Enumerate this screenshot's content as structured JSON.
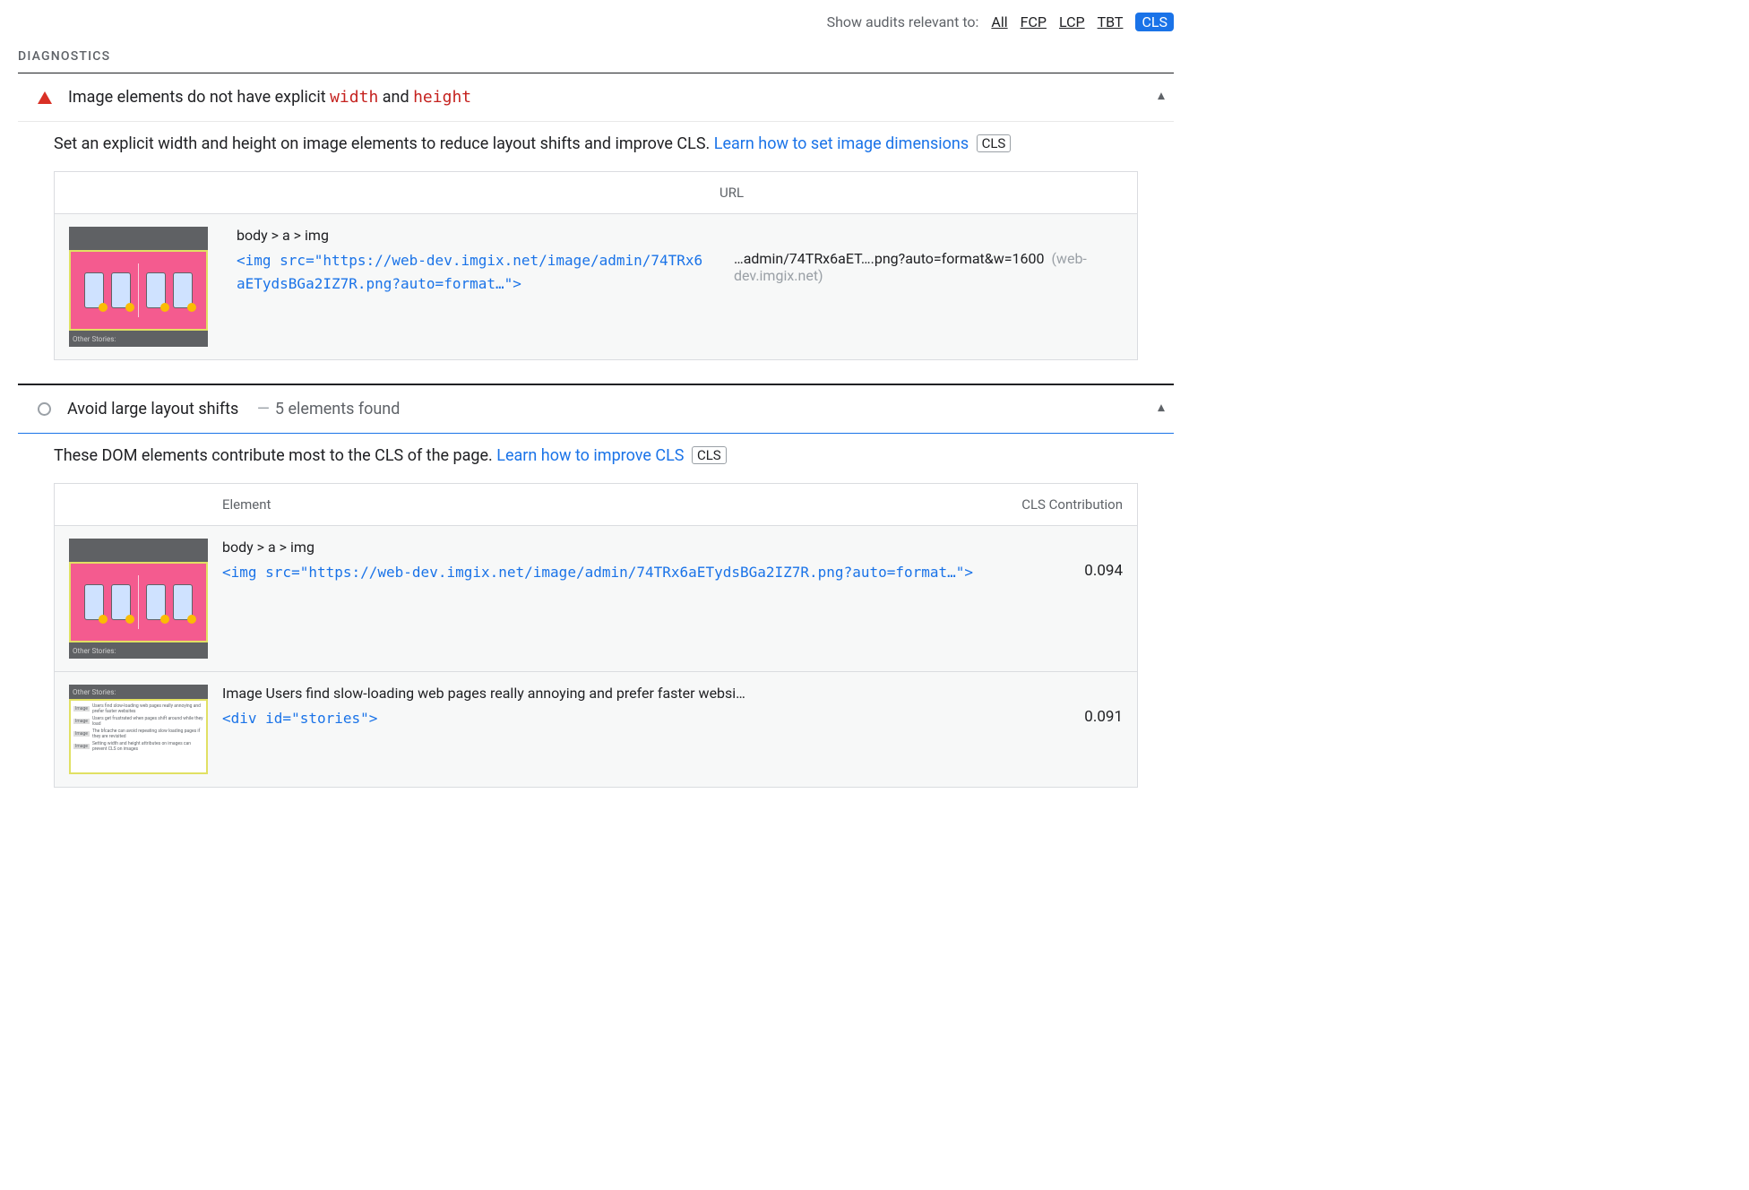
{
  "filter": {
    "label": "Show audits relevant to:",
    "items": [
      "All",
      "FCP",
      "LCP",
      "TBT",
      "CLS"
    ],
    "active": "CLS"
  },
  "section_title": "DIAGNOSTICS",
  "audit1": {
    "title_prefix": "Image elements do not have explicit ",
    "code1": "width",
    "mid": " and ",
    "code2": "height",
    "desc_text": "Set an explicit width and height on image elements to reduce layout shifts and improve CLS. ",
    "desc_link": "Learn how to set image dimensions",
    "badge": "CLS",
    "table": {
      "col_url": "URL",
      "row": {
        "selector": "body > a > img",
        "snippet": "<img src=\"https://web-dev.imgix.net/image/admin/74TRx6aETydsBGa2IZ7R.png?auto=format…\">",
        "url": "…admin/74TRx6aET….png?auto=format&w=1600",
        "host": "(web-dev.imgix.net)",
        "thumbLabel": "Other Stories:"
      }
    }
  },
  "audit2": {
    "title": "Avoid large layout shifts",
    "meta_count": "5 elements found",
    "desc_text": "These DOM elements contribute most to the CLS of the page. ",
    "desc_link": "Learn how to improve CLS",
    "badge": "CLS",
    "table": {
      "col_element": "Element",
      "col_score": "CLS Contribution",
      "rows": [
        {
          "selector": "body > a > img",
          "snippet": "<img src=\"https://web-dev.imgix.net/image/admin/74TRx6aETydsBGa2IZ7R.png?auto=format…\">",
          "score": "0.094",
          "thumbLabel": "Other Stories:"
        },
        {
          "selector": "Image Users find slow-loading web pages really annoying and prefer faster websi…",
          "snippet": "<div id=\"stories\">",
          "score": "0.091",
          "thumbLabel": "Other Stories:"
        }
      ]
    }
  },
  "thumb2_lines": [
    "Users find slow-loading web pages really annoying and prefer faster websites",
    "Users get frustrated when pages shift around while they load",
    "The bfcache can avoid repeating slow loading pages if they are revisited",
    "Setting width and height attributes on images can prevent CLS on images"
  ]
}
